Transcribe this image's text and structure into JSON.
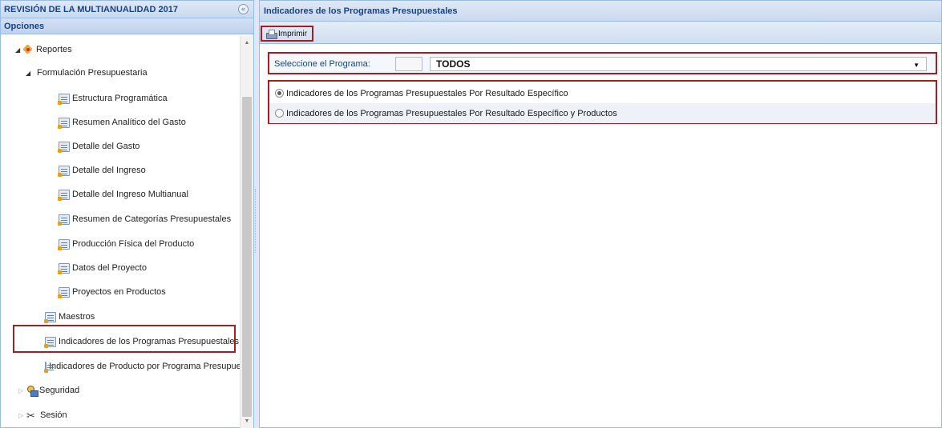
{
  "left_panel": {
    "title": "REVISIÓN DE LA MULTIANUALIDAD 2017",
    "collapse_glyph": "«",
    "options_label": "Opciones",
    "tree": {
      "reportes": "Reportes",
      "formulacion": "Formulación Presupuestaria",
      "items": [
        "Estructura Programática",
        "Resumen Analítico del Gasto",
        "Detalle del Gasto",
        "Detalle del Ingreso",
        "Detalle del Ingreso Multianual",
        "Resumen de Categorías Presupuestales",
        "Producción Física del Producto",
        "Datos del Proyecto",
        "Proyectos en Productos"
      ],
      "maestros": "Maestros",
      "indicadores_programas": "Indicadores de los Programas Presupuestales",
      "indicadores_producto": "Indicadores de Producto por Programa Presupue",
      "seguridad": "Seguridad",
      "sesion": "Sesión"
    }
  },
  "right_panel": {
    "title": "Indicadores de los Programas Presupuestales",
    "toolbar": {
      "print_label": "Imprimir"
    },
    "program": {
      "label": "Seleccione el Programa:",
      "code_value": "",
      "selected": "TODOS"
    },
    "radios": [
      {
        "label": "Indicadores de los Programas Presupuestales Por Resultado Específico",
        "checked": true
      },
      {
        "label": "Indicadores de los Programas Presupuestales Por Resultado Específico y Productos",
        "checked": false
      }
    ]
  },
  "colors": {
    "highlight": "#a31e22",
    "header_text": "#15428b",
    "panel_border": "#99bbe8"
  }
}
